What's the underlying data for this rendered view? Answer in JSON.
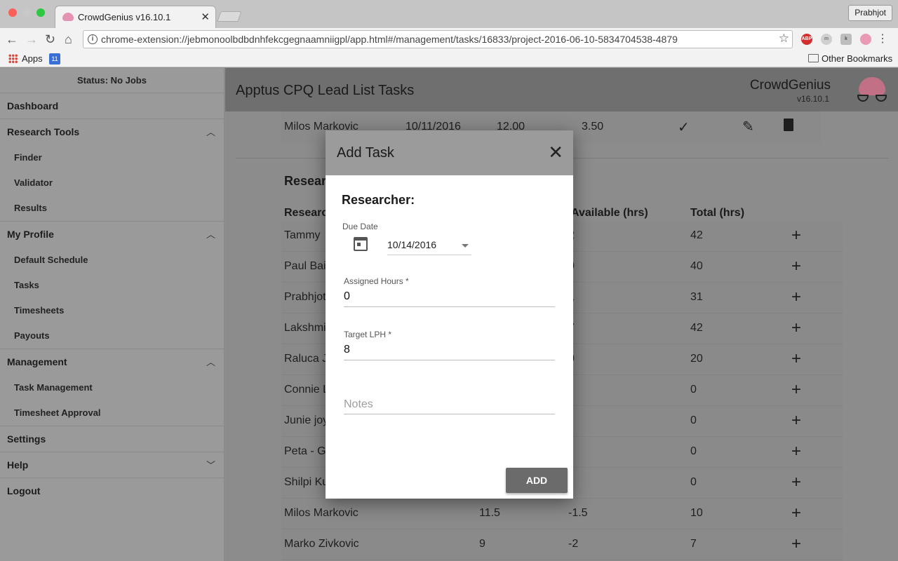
{
  "browser": {
    "tab_title": "CrowdGenius v16.10.1",
    "url": "chrome-extension://jebmonoolbdbdnhfekcgegnaamniigpl/app.html#/management/tasks/16833/project-2016-06-10-5834704538-4879",
    "profile": "Prabhjot",
    "bookmarks": {
      "apps": "Apps",
      "calendar_day": "11",
      "other": "Other Bookmarks"
    },
    "extensions": [
      "ABP",
      "m",
      "k",
      "brain"
    ]
  },
  "sidebar": {
    "status": "Status: No Jobs",
    "dashboard": "Dashboard",
    "research_tools": {
      "label": "Research Tools",
      "items": [
        "Finder",
        "Validator",
        "Results"
      ]
    },
    "my_profile": {
      "label": "My Profile",
      "items": [
        "Default Schedule",
        "Tasks",
        "Timesheets",
        "Payouts"
      ]
    },
    "management": {
      "label": "Management",
      "items": [
        "Task Management",
        "Timesheet Approval"
      ]
    },
    "settings": "Settings",
    "help": "Help",
    "logout": "Logout"
  },
  "header": {
    "title": "Apptus CPQ Lead List Tasks",
    "brand": "CrowdGenius",
    "version": "v16.10.1"
  },
  "task_row": {
    "name": "Milos Markovic",
    "date": "10/11/2016",
    "hours": "12.00",
    "lph": "3.50"
  },
  "researchers": {
    "section_title": "Resear",
    "columns": {
      "researcher": "Researc",
      "available": "Available (hrs)",
      "total": "Total (hrs)"
    },
    "rows": [
      {
        "name": "Tammy",
        "c1": "",
        "c2": "2",
        "total": "42"
      },
      {
        "name": "Paul Bai",
        "c1": "",
        "c2": "0",
        "total": "40"
      },
      {
        "name": "Prabhjot",
        "c1": "",
        "c2": "1",
        "total": "31"
      },
      {
        "name": "Lakshmi",
        "c1": "",
        "c2": "7",
        "total": "42"
      },
      {
        "name": "Raluca J",
        "c1": "",
        "c2": "0",
        "total": "20"
      },
      {
        "name": "Connie L",
        "c1": "",
        "c2": "",
        "total": "0"
      },
      {
        "name": "Junie joy",
        "c1": "",
        "c2": "",
        "total": "0"
      },
      {
        "name": "Peta - Ga",
        "c1": "",
        "c2": "",
        "total": "0"
      },
      {
        "name": "Shilpi Ku",
        "c1": "",
        "c2": "",
        "total": "0"
      },
      {
        "name": "Milos Markovic",
        "c1": "11.5",
        "c2": "-1.5",
        "total": "10"
      },
      {
        "name": "Marko Zivkovic",
        "c1": "9",
        "c2": "-2",
        "total": "7"
      }
    ]
  },
  "modal": {
    "title": "Add Task",
    "researcher_label": "Researcher:",
    "due_date_label": "Due Date",
    "due_date_value": "10/14/2016",
    "assigned_hours_label": "Assigned Hours *",
    "assigned_hours_value": "0",
    "target_lph_label": "Target LPH *",
    "target_lph_value": "8",
    "notes_placeholder": "Notes",
    "add_button": "ADD"
  }
}
